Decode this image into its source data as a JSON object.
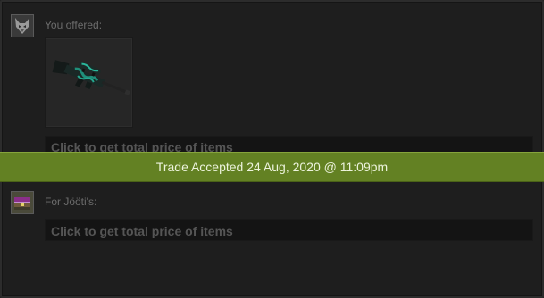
{
  "offer": {
    "you": {
      "label": "You offered:",
      "avatar_icon": "wolf-avatar-icon",
      "items": [
        {
          "icon": "awp-rifle-icon",
          "accent": "#1f8f7a"
        }
      ],
      "price_button": "Click to get total price of items"
    },
    "them": {
      "label": "For Jööti's:",
      "avatar_icon": "chest-avatar-icon",
      "items": [],
      "price_button": "Click to get total price of items"
    }
  },
  "status": {
    "text": "Trade Accepted 24 Aug, 2020 @ 11:09pm",
    "color": "#638123"
  }
}
